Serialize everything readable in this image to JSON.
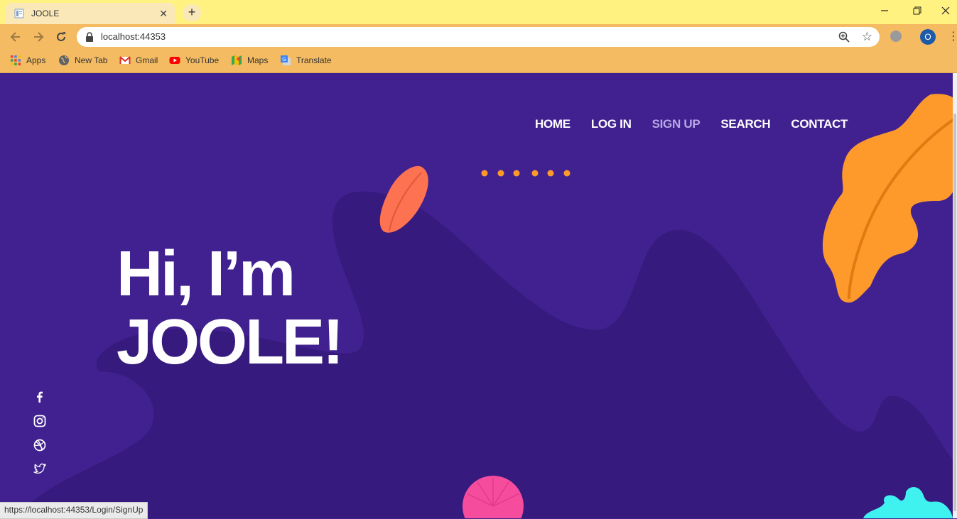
{
  "browser": {
    "tab_title": "JOOLE",
    "new_tab_symbol": "+",
    "close_symbol": "✕",
    "url": "localhost:44353",
    "profile_initial": "O",
    "bookmarks": [
      {
        "label": "Apps",
        "icon": "apps-grid-icon"
      },
      {
        "label": "New Tab",
        "icon": "globe-icon"
      },
      {
        "label": "Gmail",
        "icon": "gmail-icon"
      },
      {
        "label": "YouTube",
        "icon": "youtube-icon"
      },
      {
        "label": "Maps",
        "icon": "maps-icon"
      },
      {
        "label": "Translate",
        "icon": "translate-icon"
      }
    ],
    "status_url": "https://localhost:44353/Login/SignUp"
  },
  "nav": {
    "items": [
      {
        "label": "HOME"
      },
      {
        "label": "LOG IN"
      },
      {
        "label": "SIGN UP"
      },
      {
        "label": "SEARCH"
      },
      {
        "label": "CONTACT"
      }
    ],
    "active": "SIGN UP"
  },
  "hero": {
    "line1": "Hi, I’m",
    "line2": "JOOLE!"
  },
  "social": [
    "facebook-icon",
    "instagram-icon",
    "dribbble-icon",
    "twitter-icon"
  ],
  "colors": {
    "background": "#41218f",
    "wave": "#361a7d",
    "leaf_orange": "#fd9a2b",
    "leaf_coral": "#fd7251",
    "pink": "#f64c9e",
    "cyan": "#3ff2f0",
    "dots": "#fd9a2b"
  }
}
